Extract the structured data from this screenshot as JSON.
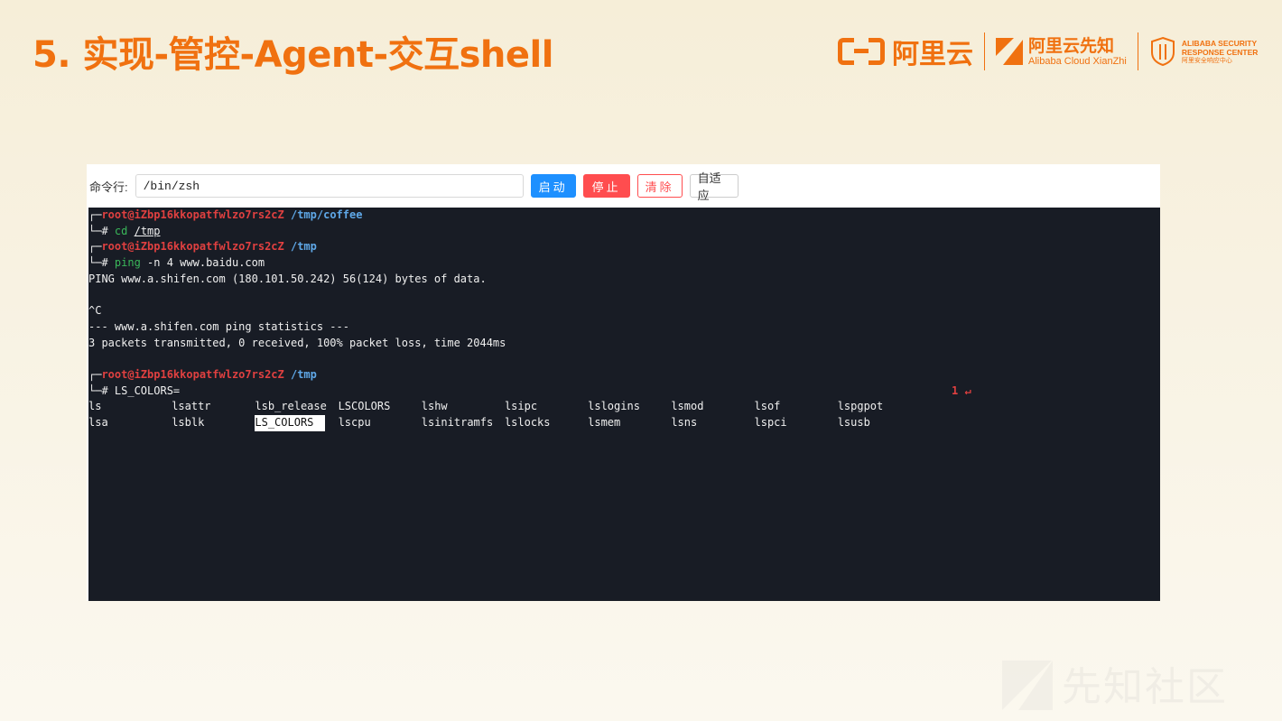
{
  "slide": {
    "title": "5. 实现-管控-Agent-交互shell"
  },
  "logos": {
    "aliyun_text": "阿里云",
    "xianzhi_cn": "阿里云先知",
    "xianzhi_en": "Alibaba Cloud XianZhi",
    "asrc_line1": "ALIBABA SECURITY",
    "asrc_line2": "RESPONSE CENTER",
    "asrc_line3": "阿里安全响应中心"
  },
  "toolbar": {
    "cmd_label": "命令行:",
    "cmd_value": "/bin/zsh",
    "start_label": "启动",
    "stop_label": "停止",
    "clear_label": "清除",
    "fit_label": "自适应"
  },
  "terminal": {
    "prompt1_user": "root@iZbp16kkopatfwlzo7rs2cZ",
    "prompt1_path": "/tmp/coffee",
    "cmd1_name": "cd",
    "cmd1_arg": "/tmp",
    "prompt2_user": "root@iZbp16kkopatfwlzo7rs2cZ",
    "prompt2_path": "/tmp",
    "cmd2_name": "ping",
    "cmd2_args": "-n 4 www.baidu.com",
    "out_ping": "PING www.a.shifen.com (180.101.50.242) 56(124) bytes of data.",
    "out_ctrlc": "^C",
    "out_stats_head": "--- www.a.shifen.com ping statistics ---",
    "out_stats": "3 packets transmitted, 0 received, 100% packet loss, time 2044ms",
    "prompt3_user": "root@iZbp16kkopatfwlzo7rs2cZ",
    "prompt3_path": "/tmp",
    "cmd3_text": "LS_COLORS=",
    "marker": "1 ↵",
    "completion_row1": [
      "ls",
      "lsattr",
      "lsb_release",
      "LSCOLORS",
      "lshw",
      "lsipc",
      "lslogins",
      "lsmod",
      "lsof",
      "lspgpot"
    ],
    "completion_row2": [
      "lsa",
      "lsblk",
      "LS_COLORS",
      "lscpu",
      "lsinitramfs",
      "lslocks",
      "lsmem",
      "lsns",
      "lspci",
      "lsusb"
    ]
  },
  "watermark": {
    "text": "先知社区"
  }
}
